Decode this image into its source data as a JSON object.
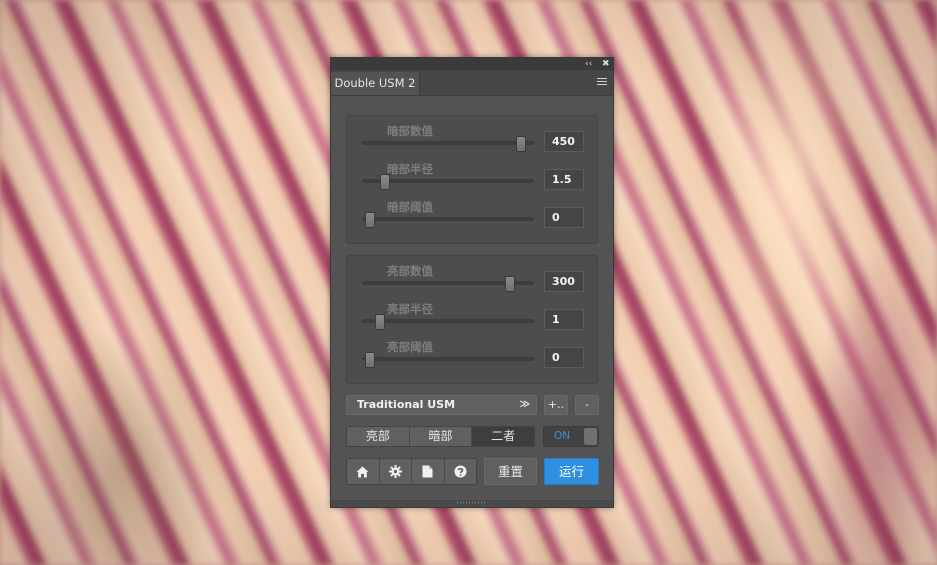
{
  "window": {
    "collapse_glyph": "‹‹",
    "close_glyph": "✖",
    "tab_title": "Double USM 2"
  },
  "dark_group": [
    {
      "label": "暗部数值",
      "value": "450",
      "level": 0.95
    },
    {
      "label": "暗部半径",
      "value": "1.5",
      "level": 0.11
    },
    {
      "label": "暗部阈值",
      "value": "0",
      "level": 0.02
    }
  ],
  "light_group": [
    {
      "label": "亮部数值",
      "value": "300",
      "level": 0.88
    },
    {
      "label": "亮部半径",
      "value": "1",
      "level": 0.08
    },
    {
      "label": "亮部阈值",
      "value": "0",
      "level": 0.02
    }
  ],
  "preset": {
    "selected": "Traditional USM",
    "chevron_glyph": "≫",
    "add_label": "+..",
    "remove_label": "-"
  },
  "mode_tabs": {
    "items": [
      "亮部",
      "暗部",
      "二者"
    ],
    "active_index": 2
  },
  "toggle": {
    "label": "ON",
    "color": "#3d8fd8"
  },
  "icons": [
    "home-icon",
    "gear-icon",
    "document-icon",
    "help-icon"
  ],
  "buttons": {
    "reset": "重置",
    "run": "运行"
  },
  "colors": {
    "accent": "#2f8fe0",
    "panel_bg": "#535353"
  }
}
